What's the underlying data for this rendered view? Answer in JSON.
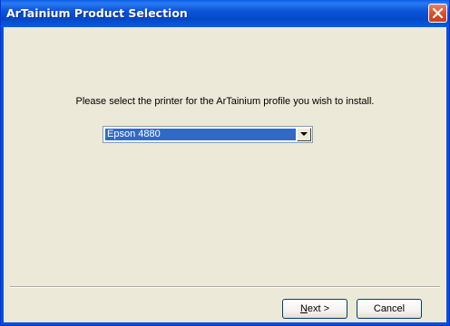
{
  "window": {
    "title": "ArTainium Product Selection",
    "close_icon": "close-icon"
  },
  "main": {
    "prompt": "Please select the printer for the ArTainium profile you wish to install.",
    "printer_select": {
      "selected": "Epson 4880",
      "arrow_icon": "chevron-down-icon"
    }
  },
  "footer": {
    "next_label_accel": "N",
    "next_label_rest": "ext >",
    "cancel_label": "Cancel"
  },
  "colors": {
    "titlebar": "#0a55d8",
    "background": "#ece9d8",
    "selection": "#316ac5",
    "close": "#d8522d"
  }
}
